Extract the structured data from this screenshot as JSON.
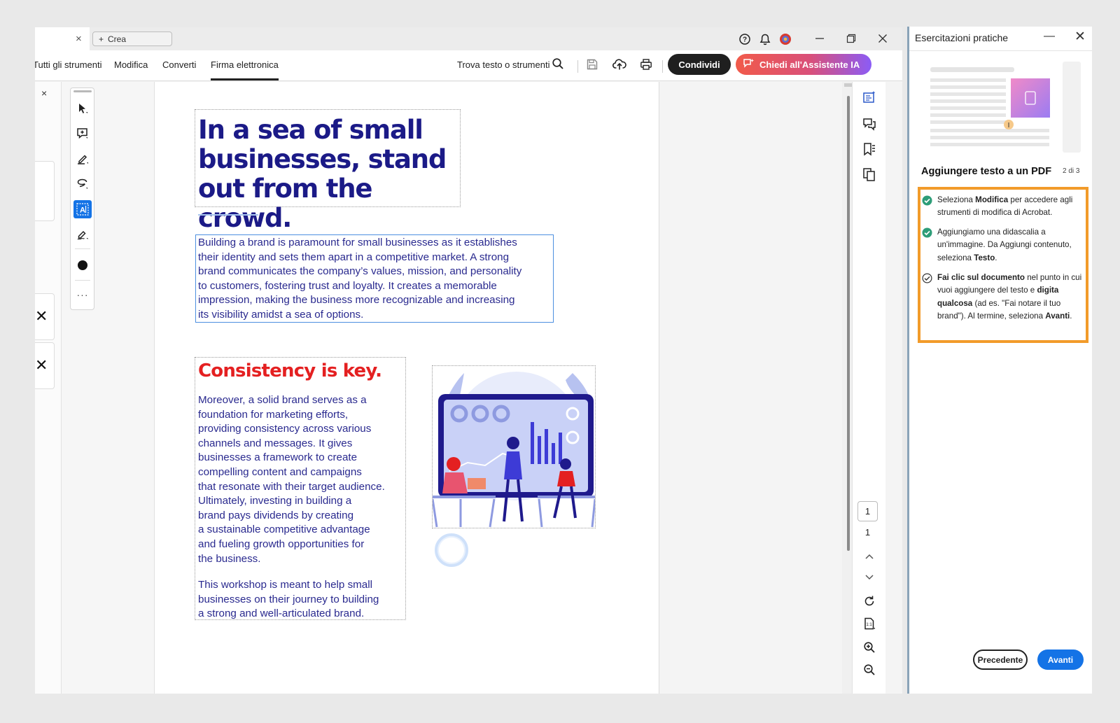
{
  "titlebar": {
    "tab_close": "×",
    "new_tab_label": "Crea",
    "new_tab_plus": "+"
  },
  "toolbar": {
    "menu": [
      "Tutti gli strumenti",
      "Modifica",
      "Converti",
      "Firma elettronica"
    ],
    "active_menu": "Firma elettronica",
    "find_label": "Trova testo o strumenti",
    "share_label": "Condividi",
    "ai_label": "Chiedi all'Assistente IA"
  },
  "left_panel": {
    "close": "×",
    "dismiss_1": "✕",
    "dismiss_2": "✕"
  },
  "draw_tools": {
    "selected": "text-box",
    "more": "···",
    "current_color": "#111111"
  },
  "document": {
    "heading": "In a sea of small businesses, stand out from the crowd.",
    "intro": "Building a brand is paramount for small businesses as it establishes\ntheir identity and sets them apart in a competitive market. A strong\nbrand communicates the company’s values, mission, and personality\nto customers, fostering trust and loyalty. It creates a memorable\nimpression, making the business more recognizable and increasing\nits visibility amidst a sea of options.",
    "subheading": "Consistency is key.",
    "body": "Moreover, a solid brand serves as a\nfoundation for marketing efforts,\nproviding consistency across various\nchannels and messages. It gives\nbusinesses a framework to create\ncompelling content and campaigns\nthat resonate with their target audience.\nUltimately, investing in building a\nbrand pays dividends by creating\na sustainable competitive advantage\nand fueling growth opportunities for\nthe business.",
    "body_2": "This workshop is meant to help small\nbusinesses on their journey to building\na strong and well-articulated brand.",
    "heading_color": "#1b1a87",
    "subheading_color": "#e42021"
  },
  "page_nav": {
    "current_page": "1",
    "total_pages": "1"
  },
  "side_window": {
    "title": "Esercitazioni pratiche",
    "minimize": "—",
    "close": "✕",
    "lesson_title": "Aggiungere testo a un PDF",
    "lesson_step": "2 di 3",
    "steps": [
      {
        "done": true,
        "parts": [
          "Seleziona ",
          "Modifica",
          " per accedere agli strumenti di modifica di Acrobat."
        ]
      },
      {
        "done": true,
        "parts": [
          "Aggiungiamo una didascalia a un'immagine. Da Aggiungi contenuto, seleziona ",
          "Testo",
          "."
        ]
      },
      {
        "done": false,
        "parts": [
          "Fai clic sul documento",
          " nel punto in cui vuoi aggiungere del testo e ",
          "digita qualcosa",
          " (ad es. \"Fai notare il tuo brand\"). Al termine, seleziona ",
          "Avanti",
          "."
        ]
      }
    ],
    "prev_label": "Precedente",
    "next_label": "Avanti",
    "highlight_color": "#f29b2a",
    "accent_color": "#1473e6"
  }
}
